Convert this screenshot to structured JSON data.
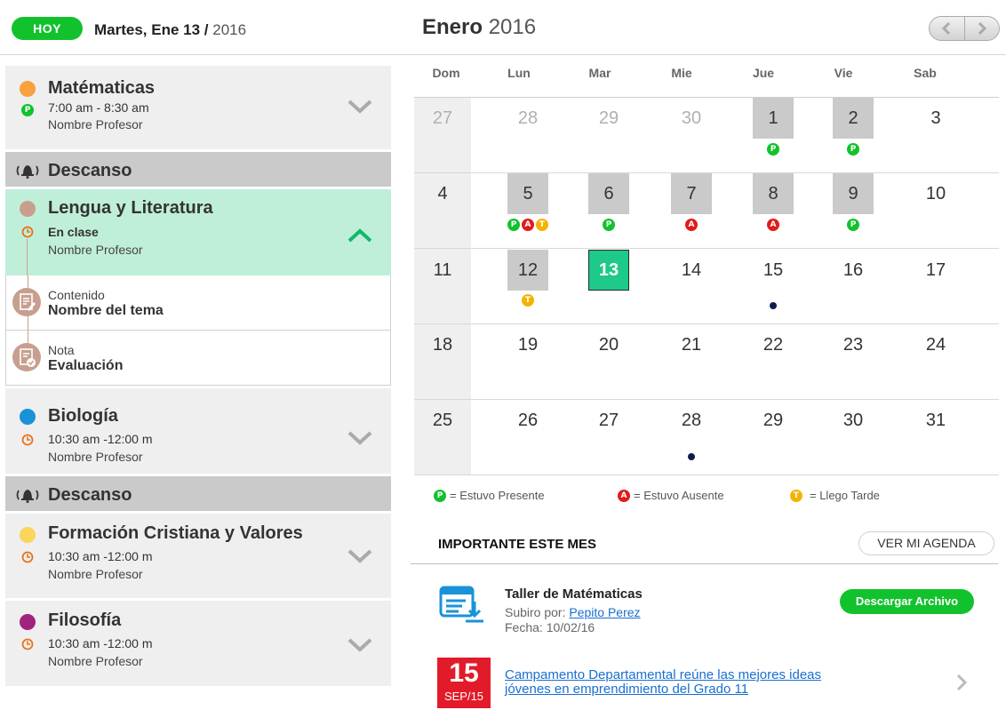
{
  "header": {
    "today_label": "HOY",
    "date_prefix": "Martes, Ene 13 / ",
    "date_year": "2016",
    "month": "Enero",
    "month_year": "2016"
  },
  "schedule": {
    "items": [
      {
        "name": "Matématicas",
        "color": "#f9a03f",
        "line1": "7:00 am - 8:30 am",
        "line2": "Nombre Profesor",
        "marker": "P"
      },
      {
        "break_label": "Descanso"
      },
      {
        "name": "Lengua y Literatura",
        "color": "#c89f8f",
        "status": "En clase",
        "line2": "Nombre Profesor",
        "details": [
          {
            "label": "Contenido",
            "value": "Nombre del tema"
          },
          {
            "label": "Nota",
            "value": "Evaluación"
          }
        ]
      },
      {
        "name": "Biología",
        "color": "#1a92d8",
        "line1": "10:30 am -12:00 m",
        "line2": "Nombre Profesor"
      },
      {
        "break_label": "Descanso"
      },
      {
        "name": "Formación Cristiana y Valores",
        "color": "#fbd65a",
        "line1": "10:30 am -12:00 m",
        "line2": "Nombre Profesor"
      },
      {
        "name": "Filosofía",
        "color": "#a0237d",
        "line1": "10:30 am -12:00 m",
        "line2": "Nombre Profesor"
      }
    ]
  },
  "calendar": {
    "day_names": [
      "Dom",
      "Lun",
      "Mar",
      "Mie",
      "Jue",
      "Vie",
      "Sab"
    ],
    "weeks": [
      [
        {
          "n": "27",
          "muted": true
        },
        {
          "n": "28",
          "muted": true
        },
        {
          "n": "29",
          "muted": true
        },
        {
          "n": "30",
          "muted": true
        },
        {
          "n": "1",
          "grey": true,
          "b": [
            "P"
          ]
        },
        {
          "n": "2",
          "grey": true,
          "b": [
            "P"
          ]
        },
        {
          "n": "3"
        }
      ],
      [
        {
          "n": "4"
        },
        {
          "n": "5",
          "grey": true,
          "b": [
            "P",
            "A",
            "T"
          ]
        },
        {
          "n": "6",
          "grey": true,
          "b": [
            "P"
          ]
        },
        {
          "n": "7",
          "grey": true,
          "b": [
            "A"
          ]
        },
        {
          "n": "8",
          "grey": true,
          "b": [
            "A"
          ]
        },
        {
          "n": "9",
          "grey": true,
          "b": [
            "P"
          ]
        },
        {
          "n": "10"
        }
      ],
      [
        {
          "n": "11"
        },
        {
          "n": "12",
          "grey": true,
          "b": [
            "T"
          ]
        },
        {
          "n": "13",
          "today": true
        },
        {
          "n": "14"
        },
        {
          "n": "15",
          "dot": true
        },
        {
          "n": "16"
        },
        {
          "n": "17"
        }
      ],
      [
        {
          "n": "18"
        },
        {
          "n": "19"
        },
        {
          "n": "20"
        },
        {
          "n": "21"
        },
        {
          "n": "22"
        },
        {
          "n": "23"
        },
        {
          "n": "24"
        }
      ],
      [
        {
          "n": "25"
        },
        {
          "n": "26"
        },
        {
          "n": "27"
        },
        {
          "n": "28",
          "dot": true
        },
        {
          "n": "29"
        },
        {
          "n": "30"
        },
        {
          "n": "31"
        }
      ]
    ]
  },
  "legend": {
    "present": "= Estuvo Presente",
    "absent": "= Estuvo Ausente",
    "late": "= Llego Tarde"
  },
  "important": {
    "title": "IMPORTANTE ESTE MES",
    "agenda_button": "VER MI AGENDA",
    "file": {
      "title": "Taller de Matématicas",
      "by_label": "Subiro por: ",
      "by_name": "Pepito Perez",
      "date": "Fecha: 10/02/16",
      "download": "Descargar Archivo"
    },
    "news": {
      "day": "15",
      "month": "SEP/15",
      "text": "Campamento Departamental reúne las mejores ideas jóvenes en emprendimiento del Grado 11"
    }
  },
  "colors": {
    "accent": "#12c22d",
    "today": "#1ec98a",
    "absent": "#e21b1b",
    "late": "#f5b200",
    "news": "#e21b2a"
  }
}
